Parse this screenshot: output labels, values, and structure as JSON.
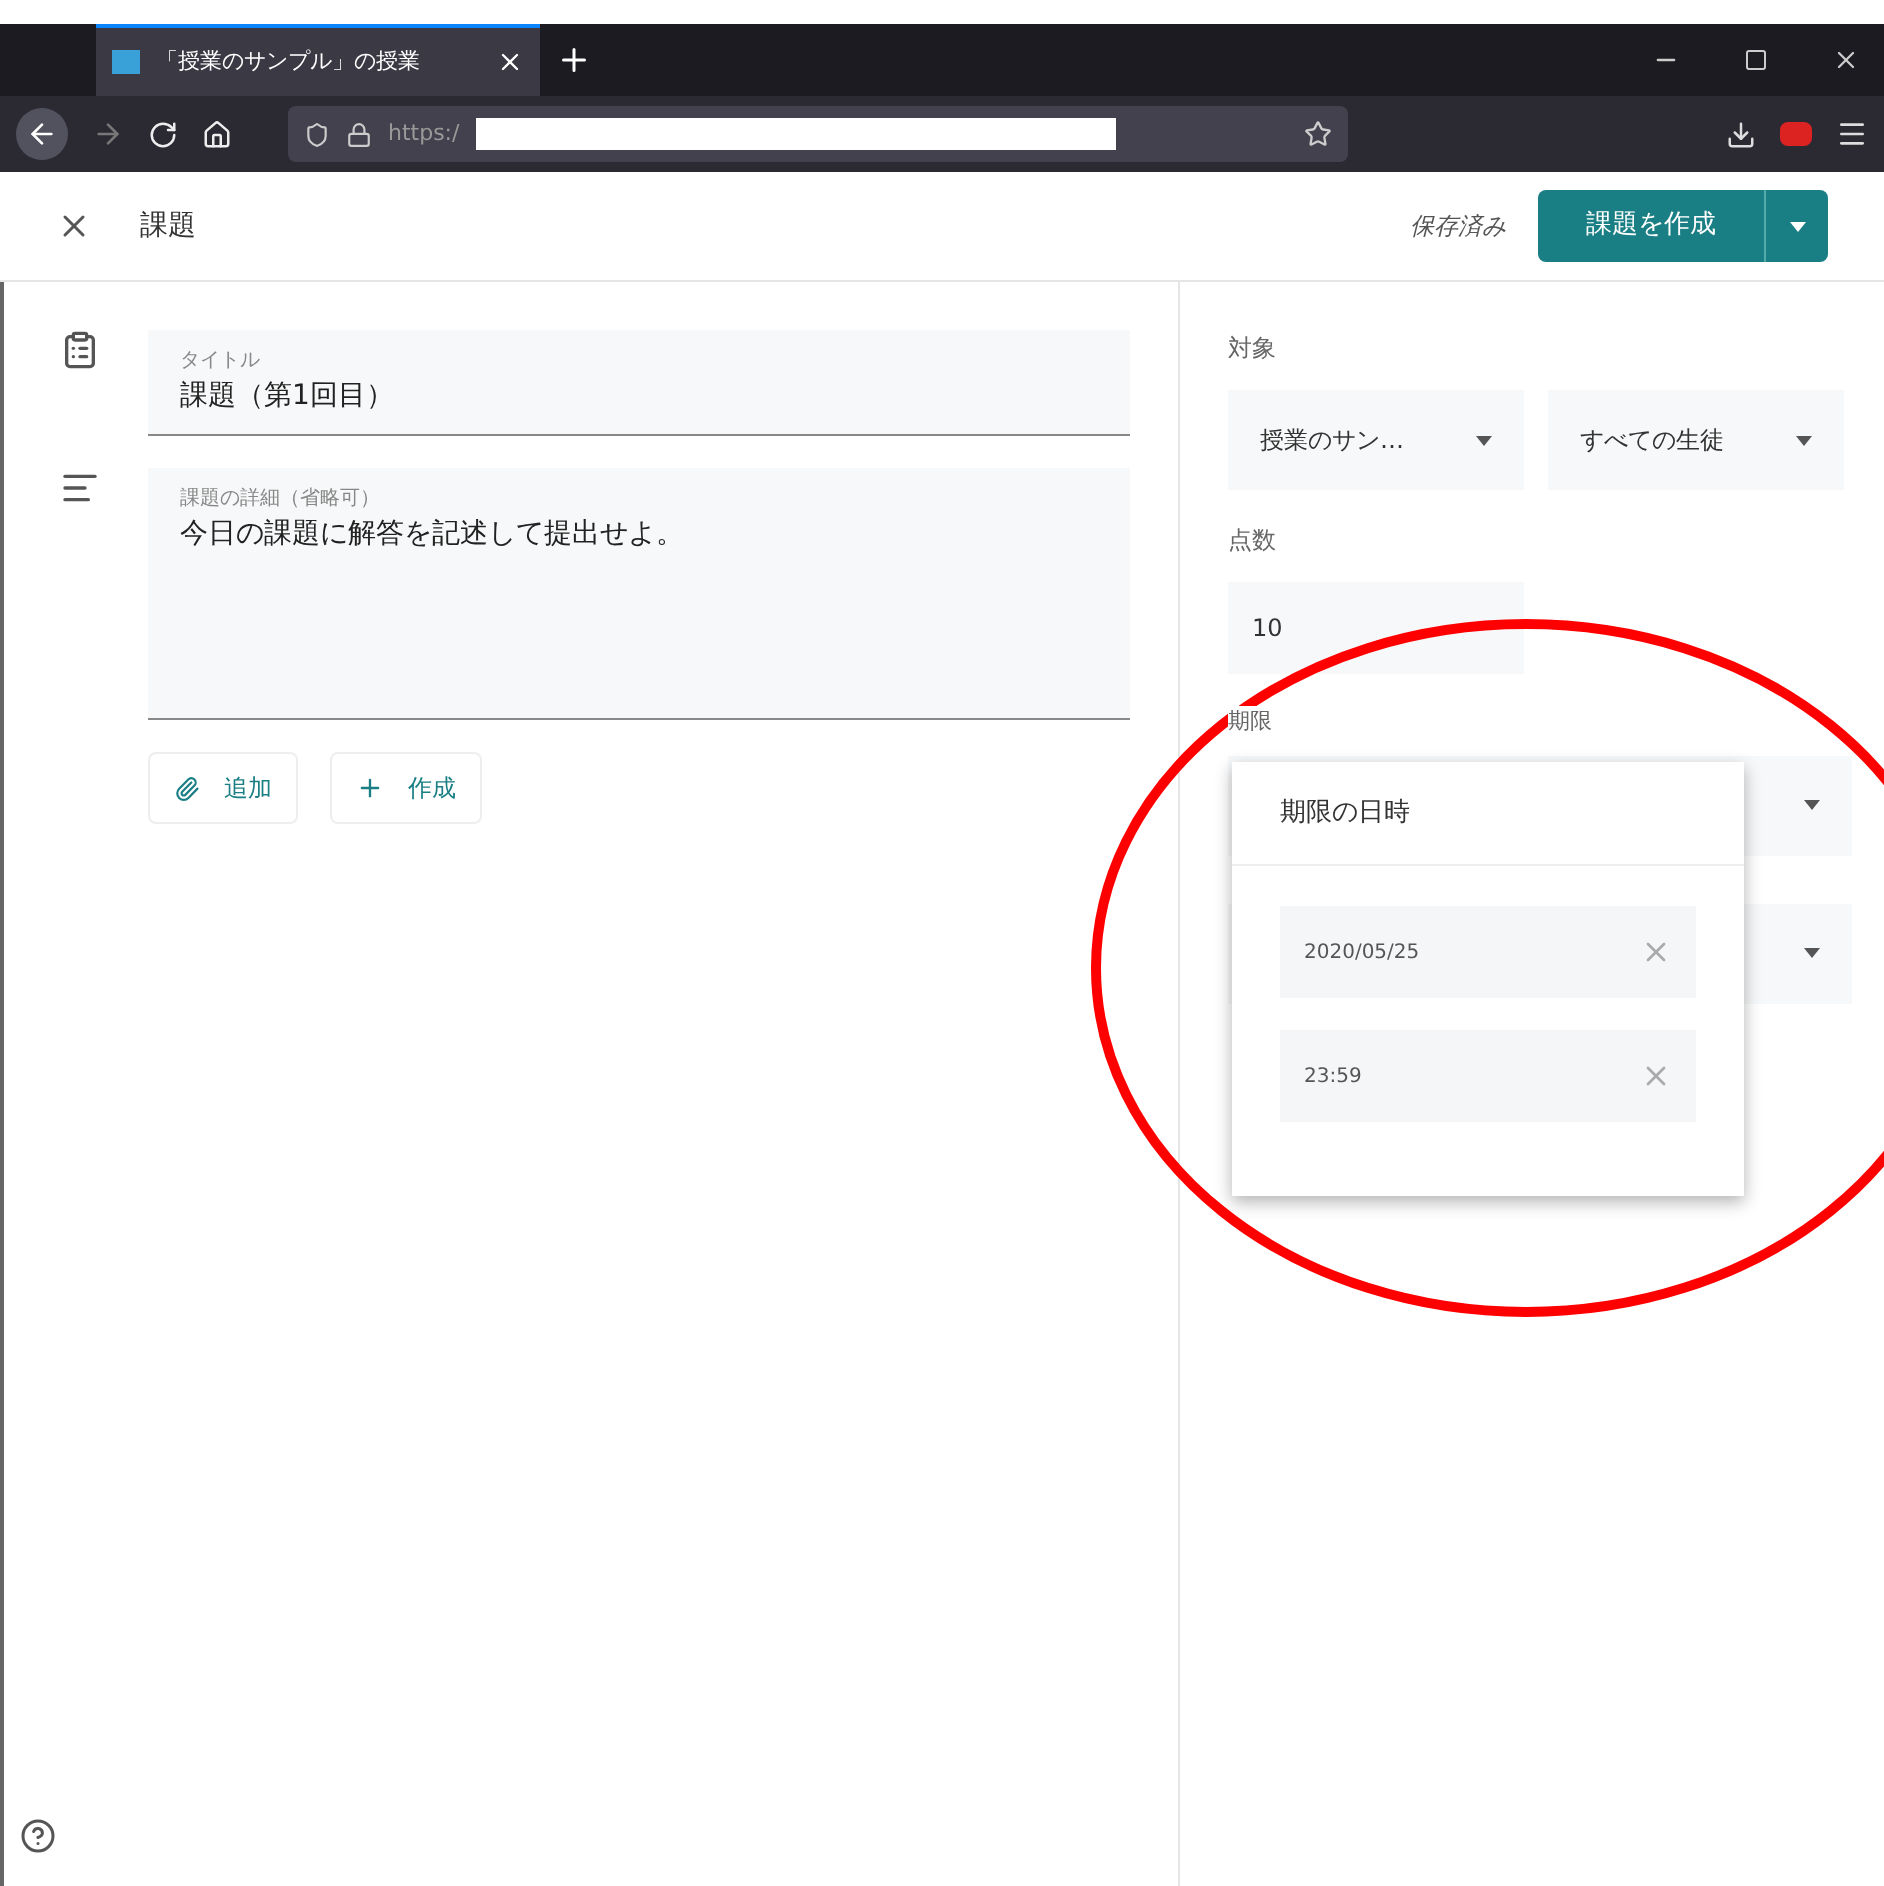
{
  "browser": {
    "tab_title": "「授業のサンプル」の授業",
    "url": "https:/"
  },
  "header": {
    "title": "課題",
    "status": "保存済み",
    "create_button": "課題を作成"
  },
  "form": {
    "title_field": {
      "label": "タイトル",
      "value": "課題（第1回目）"
    },
    "details_field": {
      "label": "課題の詳細（省略可）",
      "value": "今日の課題に解答を記述して提出せよ。"
    },
    "buttons": [
      {
        "kind": "attach",
        "label": "追加"
      },
      {
        "kind": "create",
        "label": "作成"
      }
    ]
  },
  "sidebar": {
    "target_label": "対象",
    "class_select": "授業のサン…",
    "students_select": "すべての生徒",
    "points_label": "点数",
    "points_value": "10",
    "due_label": "期限"
  },
  "due_popup": {
    "title": "期限の日時",
    "date": "2020/05/25",
    "time": "23:59"
  }
}
